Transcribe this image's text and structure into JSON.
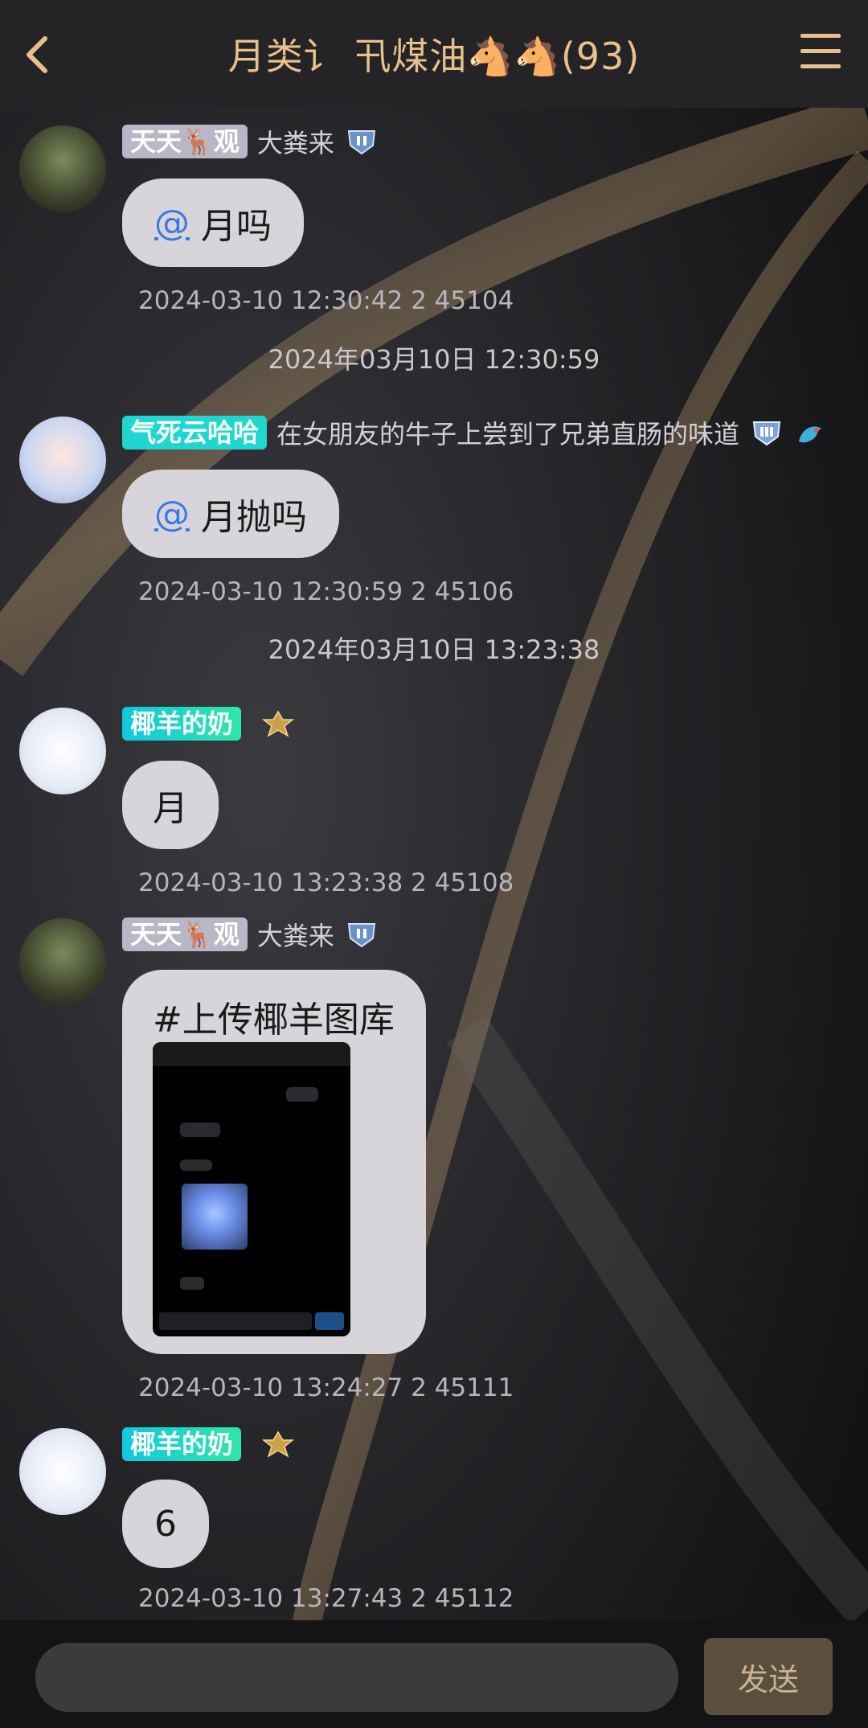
{
  "header": {
    "title": "月类讠 卂煤油🐴🐴(93)"
  },
  "messages": [
    {
      "tag": "天天🦌观",
      "signature": "大粪来",
      "content_at": "@",
      "content": "月吗",
      "meta": "2024-03-10 12:30:42 2 45104"
    },
    {
      "divider": "2024年03月10日 12:30:59"
    },
    {
      "tag": "气死云哈哈",
      "signature": "在女朋友的牛子上尝到了兄弟直肠的味道",
      "content_at": "@",
      "content": "月抛吗",
      "meta": "2024-03-10 12:30:59 2 45106"
    },
    {
      "divider": "2024年03月10日 13:23:38"
    },
    {
      "tag": "椰羊的奶",
      "signature": "",
      "content": "月",
      "meta": "2024-03-10 13:23:38 2 45108"
    },
    {
      "tag": "天天🦌观",
      "signature": "大粪来",
      "content": "#上传椰羊图库",
      "meta": "2024-03-10 13:24:27 2 45111"
    },
    {
      "tag": "椰羊的奶",
      "signature": "",
      "content": "6",
      "meta": "2024-03-10 13:27:43 2 45112"
    }
  ],
  "composer": {
    "send_label": "发送",
    "placeholder": ""
  },
  "colors": {
    "accent": "#e7c08a",
    "bubble": "#d7d5da",
    "link": "#3a7be0"
  }
}
